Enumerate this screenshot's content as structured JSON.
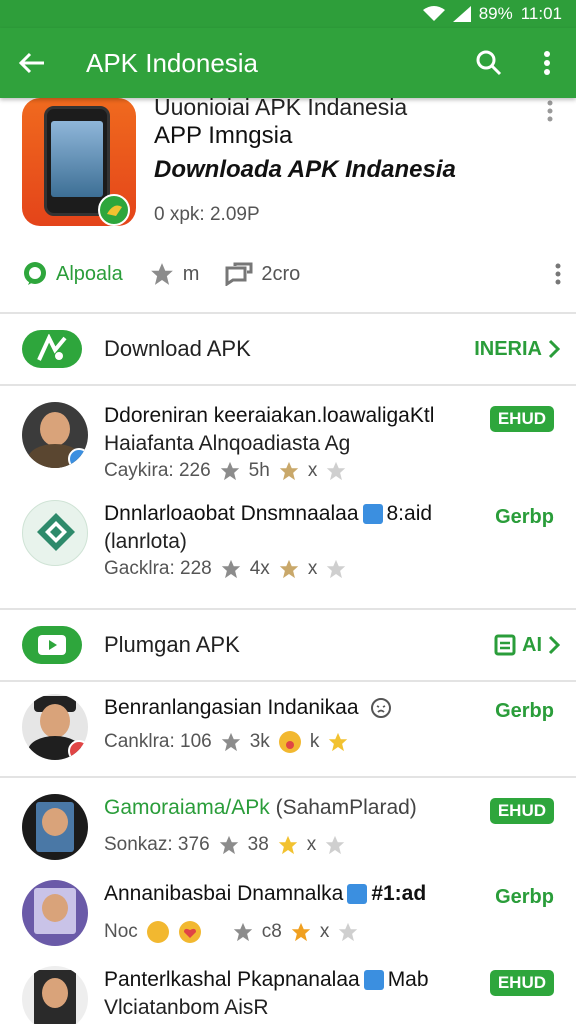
{
  "status": {
    "battery": "89%",
    "time": "11:01"
  },
  "appbar": {
    "title": "APK Indonesia"
  },
  "hero": {
    "line_top": "Uuonioiai APK Indanesia",
    "title_a": "APP Imngsia",
    "title_b": "Downloada APK Indanesia",
    "meta": "0 xpk: 2.09P",
    "actions": [
      {
        "label": "Alpoala",
        "icon": "chat-icon"
      },
      {
        "label": "m",
        "icon": "star-icon"
      },
      {
        "label": "2cro",
        "icon": "share-icon"
      }
    ]
  },
  "section1": {
    "title": "Download APK",
    "link": "INERIA"
  },
  "section2": {
    "title": "Plumgan APK",
    "link": "AI"
  },
  "rows": [
    {
      "title": "Ddoreniran keeraiakan.loawaligaKtl",
      "title2": "Haiafanta Alnqoadiasta Ag",
      "meta_a": "Caykira: 226",
      "meta_b": "5h",
      "meta_c": "x",
      "button": "EHUD"
    },
    {
      "title": "Dnnlarloaobat Dnsmnaalaa",
      "title_tail": "8:aid",
      "title2": "(lanrlota)",
      "meta_a": "Gacklra: 228",
      "meta_b": "4x",
      "meta_c": "x",
      "button": "Gerbp"
    },
    {
      "title": "Benranlangasian Indanikaa",
      "meta_a": "Canklra: 106",
      "meta_b": "3k",
      "meta_c": "k",
      "button": "Gerbp"
    },
    {
      "title": "Gamoraiama/APk",
      "title_tail": "(SahamPlarad)",
      "meta_a": "Sonkaz: 376",
      "meta_b": "38",
      "meta_c": "x",
      "button": "EHUD"
    },
    {
      "title": "Annanibasbai Dnamnalka",
      "title_tail": "#1:ad",
      "meta_a": "Noc",
      "meta_b": "c8",
      "meta_c": "x",
      "button": "Gerbp"
    },
    {
      "title": "Panterlkashal Pkapnanalaa",
      "title_tail": "Mab",
      "title2": "Vlciatanbom AisR",
      "button": "EHUD"
    }
  ],
  "colors": {
    "primary": "#30a23c",
    "accent": "#2a9d3a",
    "star_gold": "#f2c230",
    "star_gray": "#8c8c8c"
  }
}
